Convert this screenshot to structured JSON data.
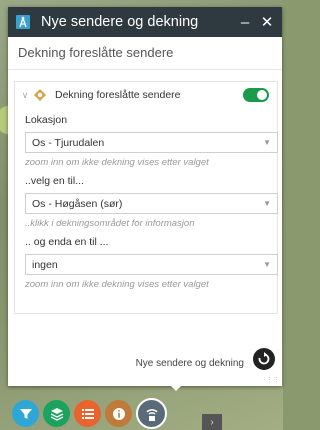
{
  "colors": {
    "titlebar_bg": "#2f3a40",
    "toggle_on": "#1a9a4b",
    "toolbar_buttons": [
      "#2ea7d6",
      "#19a35c",
      "#e8642c",
      "#c07a3a",
      "#5b6a78"
    ]
  },
  "window": {
    "title": "Nye sendere og dekning",
    "minimize_glyph": "–",
    "close_glyph": "✕"
  },
  "subtitle": "Dekning foreslåtte sendere",
  "layer": {
    "label": "Dekning foreslåtte sendere",
    "enabled": true
  },
  "form": {
    "location_label": "Lokasjon",
    "location_value": "Os - Tjurudalen",
    "location_hint": "zoom inn om ikke dekning vises etter valget",
    "select2_label": "..velg en til...",
    "select2_value": "Os - Høgåsen (sør)",
    "select2_hint": "..klikk i dekningsområdet for informasjon",
    "select3_label": ".. og enda en til ...",
    "select3_value": "ingen",
    "select3_hint": "zoom inn om ikke dekning vises etter valget"
  },
  "footer": {
    "label": "Nye sendere og dekning"
  },
  "toolbar": {
    "items": [
      "filter-icon",
      "layers-icon",
      "list-icon",
      "info-icon",
      "signal-icon"
    ],
    "active": "signal-icon",
    "more_glyph": "›"
  }
}
